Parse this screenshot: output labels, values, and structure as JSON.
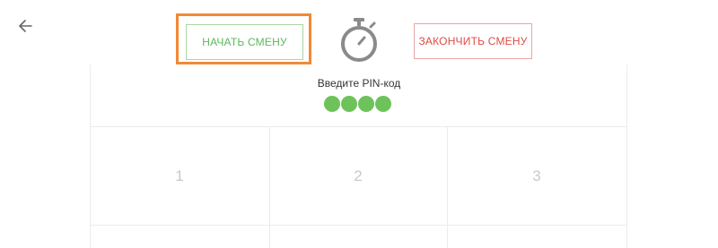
{
  "toolbar": {
    "start_shift_label": "НАЧАТЬ СМЕНУ",
    "end_shift_label": "ЗАКОНЧИТЬ СМЕНУ"
  },
  "pin": {
    "prompt": "Введите PIN-код",
    "entered_digits": 4
  },
  "keypad": {
    "keys": [
      "1",
      "2",
      "3"
    ]
  },
  "colors": {
    "highlight": "#f08a35",
    "start_green": "#5cb85c",
    "end_red": "#e04b45",
    "pin_dot": "#6dc35a"
  },
  "icons": {
    "back": "arrow-left-icon",
    "timer": "stopwatch-icon"
  }
}
